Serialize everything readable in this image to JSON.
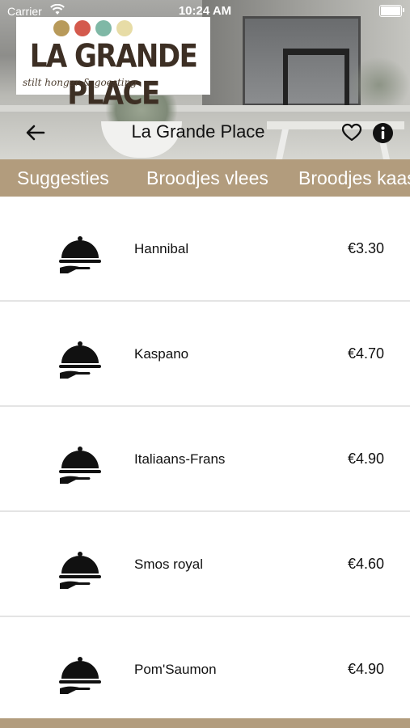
{
  "status_bar": {
    "carrier": "Carrier",
    "time": "10:24 AM"
  },
  "logo": {
    "title": "LA GRANDE PLACE",
    "tagline": "stilt honger & goesting",
    "dot_colors": [
      "#b89a5a",
      "#d45a4d",
      "#7fb8a6",
      "#e7dca6"
    ]
  },
  "navbar": {
    "title": "La Grande Place",
    "back_icon": "arrow-left-icon",
    "favorite_icon": "heart-outline-icon",
    "info_icon": "info-circle-icon"
  },
  "tabs": [
    {
      "label": "Suggesties"
    },
    {
      "label": "Broodjes vlees"
    },
    {
      "label": "Broodjes kaas"
    }
  ],
  "products": [
    {
      "name": "Hannibal",
      "price": "€3.30",
      "icon": "food-cloche-icon"
    },
    {
      "name": "Kaspano",
      "price": "€4.70",
      "icon": "food-cloche-icon"
    },
    {
      "name": "Italiaans-Frans",
      "price": "€4.90",
      "icon": "food-cloche-icon"
    },
    {
      "name": "Smos royal",
      "price": "€4.60",
      "icon": "food-cloche-icon"
    },
    {
      "name": "Pom'Saumon",
      "price": "€4.90",
      "icon": "food-cloche-icon"
    }
  ],
  "colors": {
    "accent": "#b29c7d",
    "text": "#111111",
    "divider": "#e4e4e4"
  }
}
